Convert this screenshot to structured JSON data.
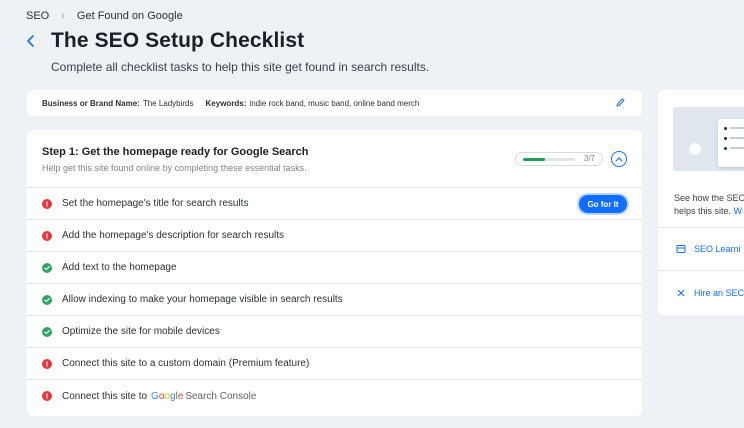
{
  "breadcrumb": {
    "root": "SEO",
    "current": "Get Found on Google"
  },
  "header": {
    "title": "The SEO Setup Checklist",
    "subtitle": "Complete all checklist tasks to help this site get found in search results."
  },
  "info": {
    "business_label": "Business or Brand Name:",
    "business_value": "The Ladybirds",
    "keywords_label": "Keywords:",
    "keywords_value": "indie rock band, music band, online band merch"
  },
  "step": {
    "title": "Step 1: Get the homepage ready for Google Search",
    "subtitle": "Help get this site found online by completing these essential tasks.",
    "progress_text": "3/7",
    "progress_fraction": 0.43
  },
  "tasks": [
    {
      "label": "Set the homepage's title for search results",
      "status": "error",
      "action": "Go for It"
    },
    {
      "label": "Add the homepage's description for search results",
      "status": "error"
    },
    {
      "label": "Add text to the homepage",
      "status": "done"
    },
    {
      "label": "Allow indexing to make your homepage visible in search results",
      "status": "done"
    },
    {
      "label": "Optimize the site for mobile devices",
      "status": "done"
    },
    {
      "label": "Connect this site to a custom domain (Premium feature)",
      "status": "error"
    },
    {
      "label": "Connect this site to",
      "status": "error",
      "brand": "Google",
      "brand_suffix": "Search Console"
    }
  ],
  "side": {
    "text_line1": "See how the SEO",
    "text_line2": "helps this site.",
    "text_link": "W",
    "link1": "SEO Learni",
    "link2": "Hire an SEC"
  },
  "colors": {
    "accent": "#116dff",
    "error": "#e0393e",
    "success": "#2ea663",
    "background": "#eef1f5"
  },
  "icons": {
    "error": "exclamation-icon",
    "success": "checkmark-icon",
    "back": "chevron-left-icon",
    "collapse": "chevron-up-icon",
    "edit": "pencil-icon"
  }
}
